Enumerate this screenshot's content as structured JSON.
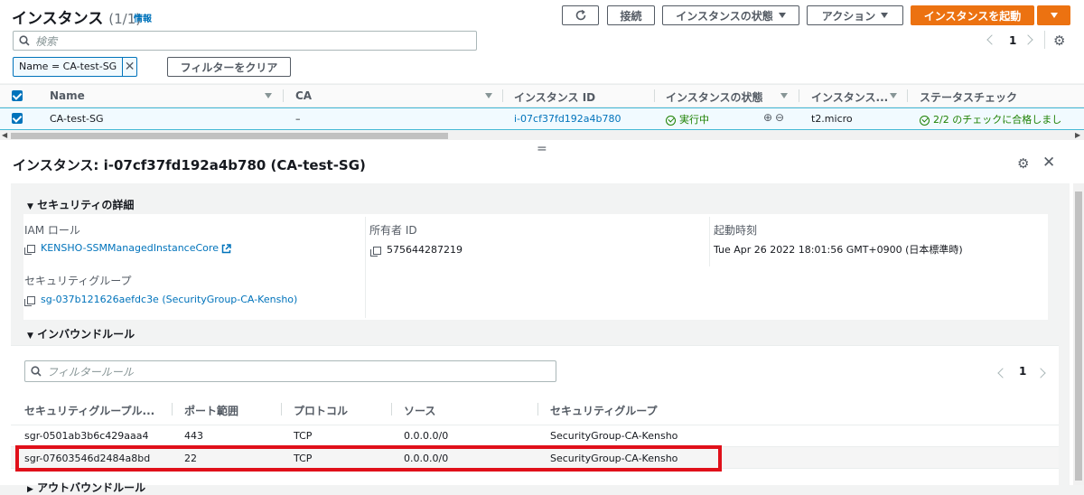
{
  "header": {
    "title": "インスタンス",
    "count": "(1/1)",
    "info_link": "情報",
    "connect_label": "接続",
    "instance_state_label": "インスタンスの状態",
    "actions_label": "アクション",
    "launch_label": "インスタンスを起動"
  },
  "search": {
    "placeholder": "検索"
  },
  "pagination": {
    "page": "1"
  },
  "filter": {
    "token": "Name = CA-test-SG",
    "clear_label": "フィルターをクリア"
  },
  "table": {
    "columns": [
      "Name",
      "CA",
      "インスタンス ID",
      "インスタンスの状態",
      "インスタンス...",
      "ステータスチェック"
    ],
    "row": {
      "name": "CA-test-SG",
      "ca": "–",
      "instance_id": "i-07cf37fd192a4b780",
      "state": "実行中",
      "type": "t2.micro",
      "status": "2/2 のチェックに合格しまし"
    }
  },
  "divider": {
    "handle": "="
  },
  "detail": {
    "title": "インスタンス: i-07cf37fd192a4b780 (CA-test-SG)",
    "security_section": "セキュリティの詳細",
    "iam_label": "IAM ロール",
    "iam_value": "KENSHO-SSMManagedInstanceCore",
    "owner_label": "所有者 ID",
    "owner_value": "575644287219",
    "launch_label": "起動時刻",
    "launch_value": "Tue Apr 26 2022 18:01:56 GMT+0900 (日本標準時)",
    "sg_label": "セキュリティグループ",
    "sg_value": "sg-037b121626aefdc3e (SecurityGroup-CA-Kensho)",
    "inbound_section": "インバウンドルール",
    "filter_placeholder": "フィルタールール",
    "page": "1",
    "outbound_section": "アウトバウンドルール"
  },
  "rules": {
    "columns": [
      "セキュリティグループル...",
      "ポート範囲",
      "プロトコル",
      "ソース",
      "セキュリティグループ"
    ],
    "rows": [
      {
        "id": "sgr-0501ab3b6c429aaa4",
        "port": "443",
        "protocol": "TCP",
        "source": "0.0.0.0/0",
        "group": "SecurityGroup-CA-Kensho"
      },
      {
        "id": "sgr-07603546d2484a8bd",
        "port": "22",
        "protocol": "TCP",
        "source": "0.0.0.0/0",
        "group": "SecurityGroup-CA-Kensho"
      }
    ]
  },
  "colors": {
    "accent": "#ec7211",
    "link": "#0073bb",
    "success": "#1d8102",
    "highlight": "#e0101a"
  }
}
